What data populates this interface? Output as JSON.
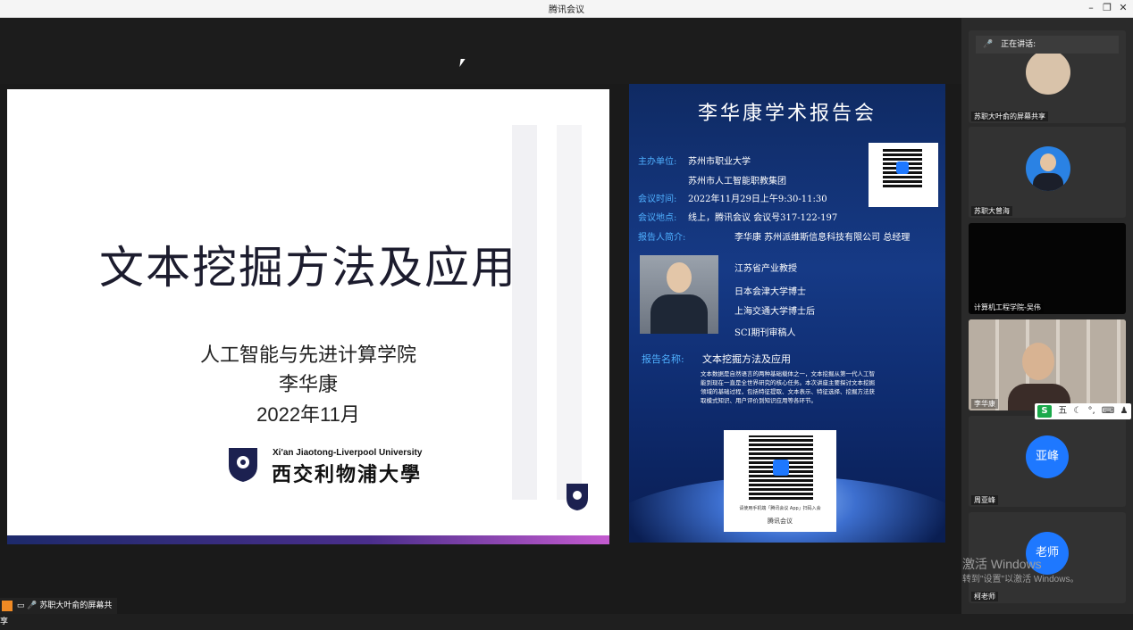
{
  "window": {
    "title": "腾讯会议",
    "min": "–",
    "restore": "❐",
    "close": "✕"
  },
  "slide": {
    "title": "文本挖掘方法及应用",
    "school": "人工智能与先进计算学院",
    "presenter": "李华康",
    "date": "2022年11月",
    "university_en": "Xi'an Jiaotong-Liverpool University",
    "university_cn": "西交利物浦大學"
  },
  "poster": {
    "title": "李华康学术报告会",
    "organizer_key": "主办单位:",
    "organizer1": "苏州市职业大学",
    "organizer2": "苏州市人工智能职教集团",
    "time_key": "会议时间:",
    "time": "2022年11月29日上午9:30-11:30",
    "place_key": "会议地点:",
    "place": "线上，腾讯会议 会议号317-122-197",
    "reporter_key": "报告人简介:",
    "reporter": "李华康 苏州派维斯信息科技有限公司 总经理",
    "creds": [
      "江苏省产业教授",
      "日本会津大学博士",
      "上海交通大学博士后",
      "SCI期刊审稿人"
    ],
    "report_key": "报告名称:",
    "report_name": "文本挖掘方法及应用",
    "abstract": "文本数据是自然语言的两种基础载体之一，文本挖掘从第一代人工智能到现在一直是全世界研究的核心任务。本次讲座主要探讨文本挖掘领域的基础过程，包括特征提取、文本表示、特征选择、挖掘方法获取模式知识、用户评价到知识应用等各环节。",
    "qr_caption": "请使用手机端「腾讯会议 App」扫码入会",
    "tencent_label": "腾讯会议"
  },
  "participants": {
    "speaking_label": "正在讲话:",
    "tiles": [
      {
        "name": "苏职大叶俞的屏幕共享"
      },
      {
        "name": "苏职大曾海"
      },
      {
        "name": "计算机工程学院-吴伟"
      },
      {
        "name": "李华康"
      },
      {
        "name": "周亚峰",
        "avatar": "亚峰"
      },
      {
        "name": "柯老师",
        "avatar": "老师"
      }
    ]
  },
  "bottom_share_label": "苏职大叶俞的屏幕共享",
  "ime": {
    "logo": "S",
    "mode": "五"
  },
  "windows_activation": {
    "line1": "激活 Windows",
    "line2": "转到\"设置\"以激活 Windows。"
  }
}
